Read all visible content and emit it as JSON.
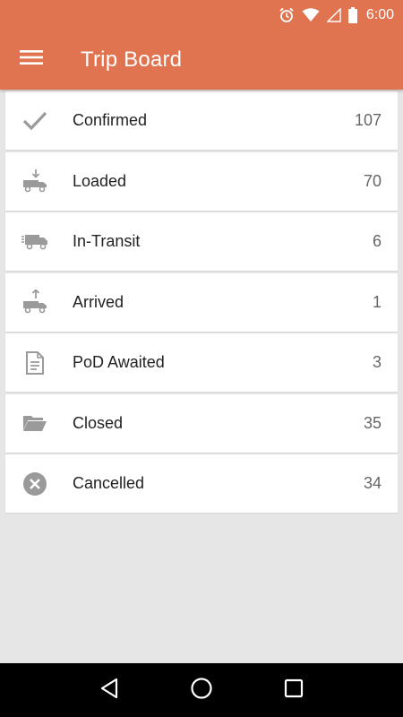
{
  "status_bar": {
    "time": "6:00"
  },
  "app_bar": {
    "title": "Trip Board"
  },
  "colors": {
    "accent": "#e07450",
    "icon_gray": "#9a9a9a"
  },
  "trip_statuses": [
    {
      "label": "Confirmed",
      "count": "107",
      "icon": "checkmark-icon"
    },
    {
      "label": "Loaded",
      "count": "70",
      "icon": "truck-loading-icon"
    },
    {
      "label": "In-Transit",
      "count": "6",
      "icon": "truck-moving-icon"
    },
    {
      "label": "Arrived",
      "count": "1",
      "icon": "truck-unloading-icon"
    },
    {
      "label": "PoD Awaited",
      "count": "3",
      "icon": "document-icon"
    },
    {
      "label": "Closed",
      "count": "35",
      "icon": "folder-open-icon"
    },
    {
      "label": "Cancelled",
      "count": "34",
      "icon": "cancel-circle-icon"
    }
  ]
}
